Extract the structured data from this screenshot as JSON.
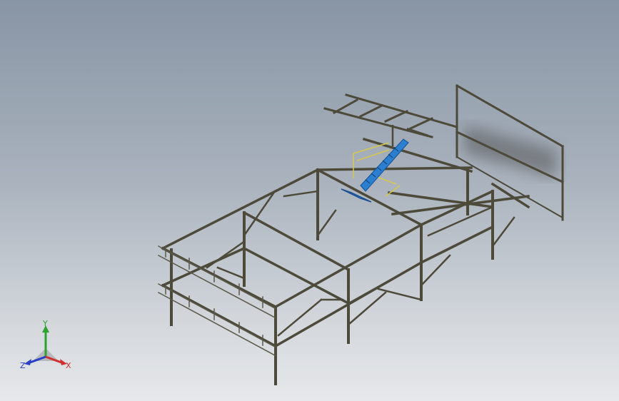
{
  "viewport": {
    "background_top": "#8895a5",
    "background_bottom": "#e6e8eb"
  },
  "model": {
    "description_icon": "steel-frame-structure",
    "frame_color": "#4d4a3a",
    "stair_color": "#2a7fd0",
    "rail_color": "#d8c84a"
  },
  "triad": {
    "x_label": "X",
    "y_label": "Y",
    "z_label": "Z",
    "x_color": "#d03030",
    "y_color": "#30a030",
    "z_color": "#2840c8"
  }
}
